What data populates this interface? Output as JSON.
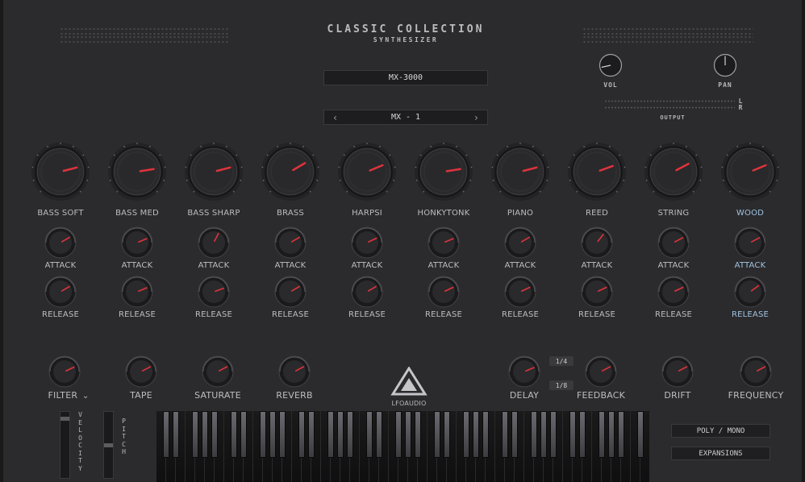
{
  "header": {
    "title": "CLASSIC COLLECTION",
    "subtitle": "SYNTHESIZER",
    "preset_name": "MX-3000",
    "program": "MX - 1",
    "prev_symbol": "‹",
    "next_symbol": "›"
  },
  "output": {
    "vol_label": "VOL",
    "pan_label": "PAN",
    "meter_label": "OUTPUT",
    "left_label": "L",
    "right_label": "R"
  },
  "voices": [
    {
      "name": "BASS SOFT",
      "attack": "ATTACK",
      "release": "RELEASE",
      "highlight": false,
      "main": 0.78,
      "att": 0.72,
      "rel": 0.72
    },
    {
      "name": "BASS MED",
      "attack": "ATTACK",
      "release": "RELEASE",
      "highlight": false,
      "main": 0.8,
      "att": 0.75,
      "rel": 0.75
    },
    {
      "name": "BASS SHARP",
      "attack": "ATTACK",
      "release": "RELEASE",
      "highlight": false,
      "main": 0.78,
      "att": 0.6,
      "rel": 0.76
    },
    {
      "name": "BRASS",
      "attack": "ATTACK",
      "release": "RELEASE",
      "highlight": false,
      "main": 0.72,
      "att": 0.72,
      "rel": 0.72
    },
    {
      "name": "HARPSI",
      "attack": "ATTACK",
      "release": "RELEASE",
      "highlight": false,
      "main": 0.75,
      "att": 0.74,
      "rel": 0.72
    },
    {
      "name": "HONKYTONK",
      "attack": "ATTACK",
      "release": "RELEASE",
      "highlight": false,
      "main": 0.8,
      "att": 0.75,
      "rel": 0.74
    },
    {
      "name": "PIANO",
      "attack": "ATTACK",
      "release": "RELEASE",
      "highlight": false,
      "main": 0.78,
      "att": 0.72,
      "rel": 0.74
    },
    {
      "name": "REED",
      "attack": "ATTACK",
      "release": "RELEASE",
      "highlight": false,
      "main": 0.76,
      "att": 0.64,
      "rel": 0.74
    },
    {
      "name": "STRING",
      "attack": "ATTACK",
      "release": "RELEASE",
      "highlight": false,
      "main": 0.73,
      "att": 0.73,
      "rel": 0.74
    },
    {
      "name": "WOOD",
      "attack": "ATTACK",
      "release": "RELEASE",
      "highlight": true,
      "main": 0.75,
      "att": 0.73,
      "rel": 0.7
    }
  ],
  "effects": {
    "filter": "FILTER",
    "filter_chevron": "⌄",
    "tape": "TAPE",
    "saturate": "SATURATE",
    "reverb": "REVERB",
    "delay": "DELAY",
    "delay_1_4": "1/4",
    "delay_1_8": "1/8",
    "feedback": "FEEDBACK",
    "drift": "DRIFT",
    "frequency": "FREQUENCY"
  },
  "logo": {
    "text": "LFOAUDIO"
  },
  "wheels": {
    "velocity": "VELOCITY",
    "pitch": "PITCH",
    "velocity_level": 0.92,
    "pitch_level": 0.5
  },
  "buttons": {
    "poly_mono": "POLY / MONO",
    "expansions": "EXPANSIONS"
  },
  "colors": {
    "accent": "#e0333d",
    "highlight_label": "#9fc2e0",
    "panel": "#2b2b2d"
  }
}
